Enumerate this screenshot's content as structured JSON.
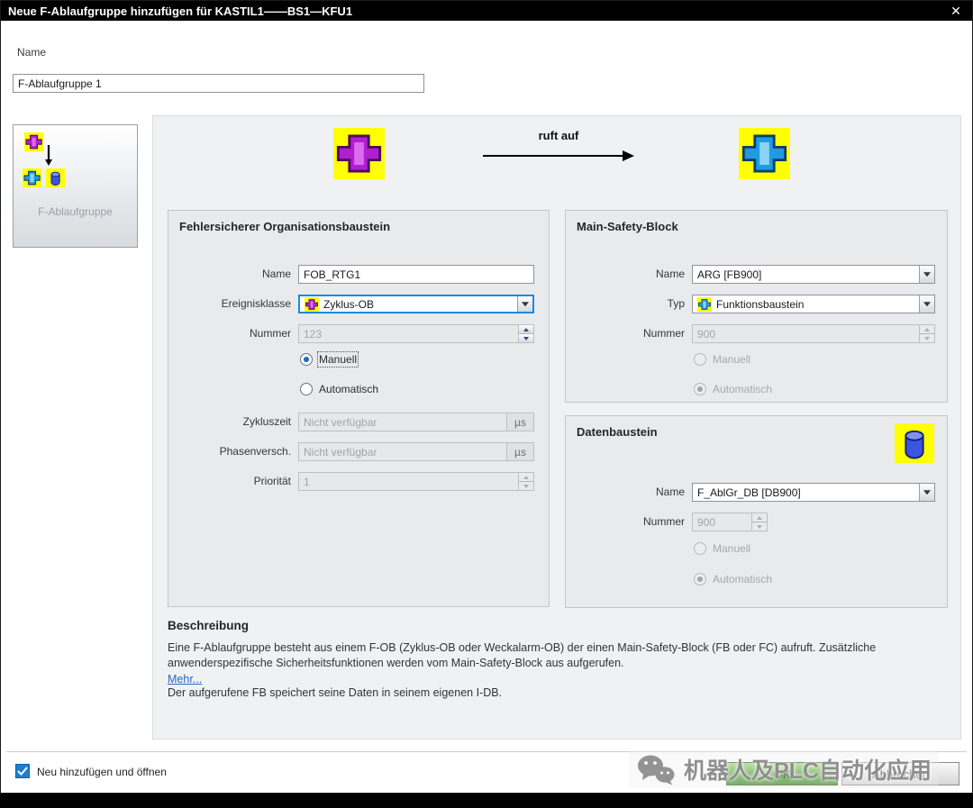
{
  "window": {
    "title": "Neue F-Ablaufgruppe hinzufügen für KASTIL1——BS1—KFU1",
    "close_glyph": "✕"
  },
  "name_field": {
    "label": "Name",
    "value": "F-Ablaufgruppe 1"
  },
  "sidebar": {
    "label": "F-Ablaufgruppe"
  },
  "diagram": {
    "caption": "ruft auf"
  },
  "fob": {
    "title": "Fehlersicherer Organisationsbaustein",
    "name_label": "Name",
    "name_value": "FOB_RTG1",
    "event_label": "Ereignisklasse",
    "event_value": "Zyklus-OB",
    "number_label": "Nummer",
    "number_value": "123",
    "manual_label": "Manuell",
    "auto_label": "Automatisch",
    "cycle_label": "Zykluszeit",
    "cycle_value": "Nicht verfügbar",
    "cycle_unit": "µs",
    "phase_label": "Phasenversch.",
    "phase_value": "Nicht verfügbar",
    "phase_unit": "µs",
    "priority_label": "Priorität",
    "priority_value": "1"
  },
  "msb": {
    "title": "Main-Safety-Block",
    "name_label": "Name",
    "name_value": "ARG [FB900]",
    "type_label": "Typ",
    "type_value": "Funktionsbaustein",
    "number_label": "Nummer",
    "number_value": "900",
    "manual_label": "Manuell",
    "auto_label": "Automatisch"
  },
  "db": {
    "title": "Datenbaustein",
    "name_label": "Name",
    "name_value": "F_AblGr_DB [DB900]",
    "number_label": "Nummer",
    "number_value": "900",
    "manual_label": "Manuell",
    "auto_label": "Automatisch"
  },
  "description": {
    "title": "Beschreibung",
    "body": "Eine F-Ablaufgruppe besteht aus einem F-OB (Zyklus-OB oder Weckalarm-OB) der einen Main-Safety-Block (FB oder FC) aufruft. Zusätzliche anwenderspezifische Sicherheitsfunktionen werden vom Main-Safety-Block aus aufgerufen.",
    "more_link": "Mehr...",
    "body2": "Der aufgerufene FB speichert seine Daten in seinem eigenen I-DB."
  },
  "footer": {
    "checkbox_label": "Neu hinzufügen und öffnen",
    "ok": "OK",
    "cancel": "Abbrechen"
  },
  "watermark": {
    "text": "机器人及PLC自动化应用"
  },
  "colors": {
    "title_bar": "#000000",
    "focus_blue": "#1b8ae0",
    "ok_green": "#4f9f33",
    "block_yellow": "#ffff00",
    "ob_purple": "#b01fd0",
    "fb_blue": "#1e9be2",
    "db_blue": "#3a55e2",
    "watermark_gray": "#8f8f8f",
    "link_blue": "#2a66c8"
  }
}
